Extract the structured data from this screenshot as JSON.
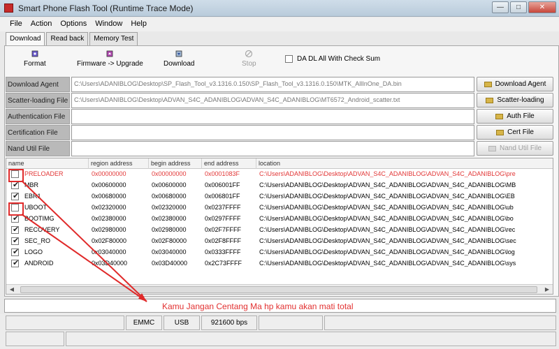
{
  "window": {
    "title": "Smart Phone Flash Tool (Runtime Trace Mode)"
  },
  "menu": [
    "File",
    "Action",
    "Options",
    "Window",
    "Help"
  ],
  "tabs": [
    "Download",
    "Read back",
    "Memory Test"
  ],
  "toolbar": {
    "format": "Format",
    "firmware_upgrade": "Firmware -> Upgrade",
    "download": "Download",
    "stop": "Stop",
    "da_dl_label": "DA DL All With Check Sum"
  },
  "fields": [
    {
      "label": "Download Agent",
      "value": "C:\\Users\\ADANIBLOG\\Desktop\\SP_Flash_Tool_v3.1316.0.150\\SP_Flash_Tool_v3.1316.0.150\\MTK_AllInOne_DA.bin"
    },
    {
      "label": "Scatter-loading File",
      "value": "C:\\Users\\ADANIBLOG\\Desktop\\ADVAN_S4C_ADANIBLOG\\ADVAN_S4C_ADANIBLOG\\MT6572_Android_scatter.txt"
    },
    {
      "label": "Authentication File",
      "value": ""
    },
    {
      "label": "Certification File",
      "value": ""
    },
    {
      "label": "Nand Util File",
      "value": ""
    }
  ],
  "side_buttons": [
    "Download Agent",
    "Scatter-loading",
    "Auth File",
    "Cert File",
    "Nand Util File"
  ],
  "table": {
    "headers": [
      "name",
      "region address",
      "begin address",
      "end address",
      "location"
    ],
    "rows": [
      {
        "checked": false,
        "name": "PRELOADER",
        "region": "0x00000000",
        "begin": "0x00000000",
        "end": "0x0001083F",
        "location": "C:\\Users\\ADANIBLOG\\Desktop\\ADVAN_S4C_ADANIBLOG\\ADVAN_S4C_ADANIBLOG\\pre"
      },
      {
        "checked": true,
        "name": "MBR",
        "region": "0x00600000",
        "begin": "0x00600000",
        "end": "0x006001FF",
        "location": "C:\\Users\\ADANIBLOG\\Desktop\\ADVAN_S4C_ADANIBLOG\\ADVAN_S4C_ADANIBLOG\\MB"
      },
      {
        "checked": true,
        "name": "EBR1",
        "region": "0x00680000",
        "begin": "0x00680000",
        "end": "0x006801FF",
        "location": "C:\\Users\\ADANIBLOG\\Desktop\\ADVAN_S4C_ADANIBLOG\\ADVAN_S4C_ADANIBLOG\\EB"
      },
      {
        "checked": false,
        "name": "UBOOT",
        "region": "0x02320000",
        "begin": "0x02320000",
        "end": "0x0237FFFF",
        "location": "C:\\Users\\ADANIBLOG\\Desktop\\ADVAN_S4C_ADANIBLOG\\ADVAN_S4C_ADANIBLOG\\ub"
      },
      {
        "checked": true,
        "name": "BOOTIMG",
        "region": "0x02380000",
        "begin": "0x02380000",
        "end": "0x0297FFFF",
        "location": "C:\\Users\\ADANIBLOG\\Desktop\\ADVAN_S4C_ADANIBLOG\\ADVAN_S4C_ADANIBLOG\\bo"
      },
      {
        "checked": true,
        "name": "RECOVERY",
        "region": "0x02980000",
        "begin": "0x02980000",
        "end": "0x02F7FFFF",
        "location": "C:\\Users\\ADANIBLOG\\Desktop\\ADVAN_S4C_ADANIBLOG\\ADVAN_S4C_ADANIBLOG\\rec"
      },
      {
        "checked": true,
        "name": "SEC_RO",
        "region": "0x02F80000",
        "begin": "0x02F80000",
        "end": "0x02F8FFFF",
        "location": "C:\\Users\\ADANIBLOG\\Desktop\\ADVAN_S4C_ADANIBLOG\\ADVAN_S4C_ADANIBLOG\\sec"
      },
      {
        "checked": true,
        "name": "LOGO",
        "region": "0x03040000",
        "begin": "0x03040000",
        "end": "0x0333FFFF",
        "location": "C:\\Users\\ADANIBLOG\\Desktop\\ADVAN_S4C_ADANIBLOG\\ADVAN_S4C_ADANIBLOG\\log"
      },
      {
        "checked": true,
        "name": "ANDROID",
        "region": "0x03D40000",
        "begin": "0x03D40000",
        "end": "0x2C73FFFF",
        "location": "C:\\Users\\ADANIBLOG\\Desktop\\ADVAN_S4C_ADANIBLOG\\ADVAN_S4C_ADANIBLOG\\sys"
      }
    ]
  },
  "annotation": {
    "text": "Kamu Jangan Centang Ma   hp kamu akan mati total",
    "color": "#e23030"
  },
  "status": {
    "storage": "EMMC",
    "port": "USB",
    "baud": "921600 bps"
  },
  "icons": {
    "format": "format-icon",
    "firmware": "firmware-upgrade-icon",
    "download": "download-icon",
    "stop": "stop-icon",
    "folder": "folder-icon"
  }
}
